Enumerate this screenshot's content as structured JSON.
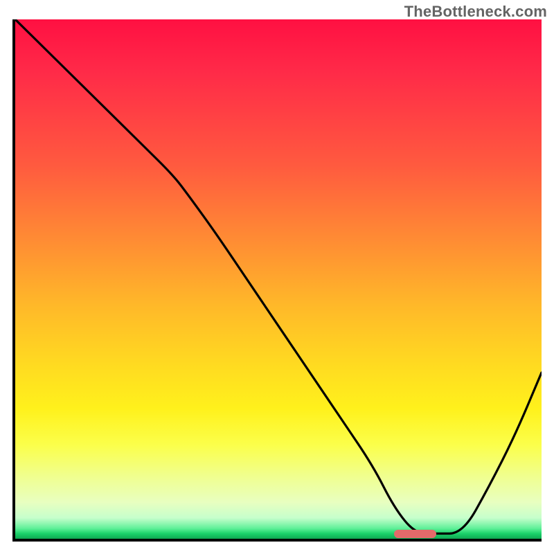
{
  "watermark": "TheBottleneck.com",
  "chart_data": {
    "type": "line",
    "title": "",
    "xlabel": "",
    "ylabel": "",
    "xlim": [
      0,
      100
    ],
    "ylim": [
      0,
      100
    ],
    "grid": false,
    "legend": false,
    "series": [
      {
        "name": "curve",
        "stroke": "#000000",
        "x": [
          0,
          6,
          12,
          18,
          24,
          30,
          33,
          38,
          44,
          50,
          56,
          62,
          68,
          72,
          76,
          80,
          85,
          90,
          95,
          100
        ],
        "values": [
          100,
          94,
          88,
          82,
          76,
          70,
          66,
          59,
          50,
          41,
          32,
          23,
          14,
          6,
          1,
          1,
          1,
          10,
          20,
          32
        ]
      }
    ],
    "markers": [
      {
        "name": "target-marker",
        "x_start": 72,
        "x_end": 80,
        "y": 1,
        "color": "#e46a6a"
      }
    ],
    "background_gradient_stops": [
      {
        "pos": 0,
        "rgb": "#ff1042"
      },
      {
        "pos": 50,
        "rgb": "#ffb829"
      },
      {
        "pos": 80,
        "rgb": "#fff11c"
      },
      {
        "pos": 95,
        "rgb": "#e8ffc0"
      },
      {
        "pos": 100,
        "rgb": "#0fa852"
      }
    ]
  }
}
